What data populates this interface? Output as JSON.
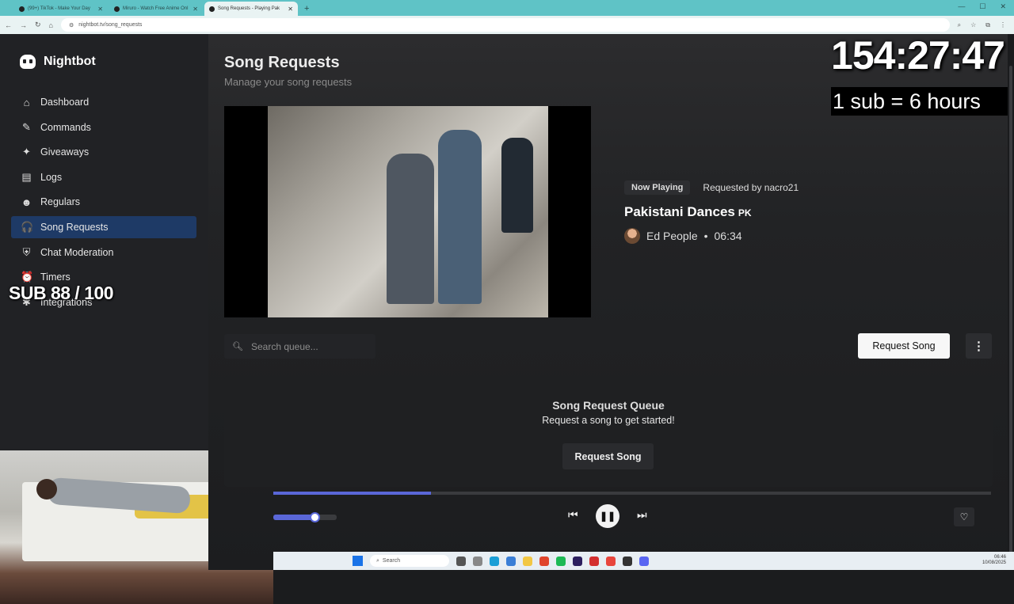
{
  "browser": {
    "tabs": [
      {
        "label": "(99+) TikTok - Make Your Day"
      },
      {
        "label": "Miruro - Watch Free Anime Onl"
      },
      {
        "label": "Song Requests - Playing Pak"
      }
    ],
    "new_tab": "+",
    "url": "nightbot.tv/song_requests"
  },
  "sidebar": {
    "brand": "Nightbot",
    "items": [
      {
        "label": "Dashboard",
        "icon": "⌂",
        "icon_name": "home-icon"
      },
      {
        "label": "Commands",
        "icon": "✎",
        "icon_name": "wand-icon"
      },
      {
        "label": "Giveaways",
        "icon": "✦",
        "icon_name": "giveaway-icon"
      },
      {
        "label": "Logs",
        "icon": "▤",
        "icon_name": "logs-icon"
      },
      {
        "label": "Regulars",
        "icon": "☻",
        "icon_name": "users-icon"
      },
      {
        "label": "Song Requests",
        "icon": "🎧",
        "icon_name": "headphones-icon",
        "active": true
      },
      {
        "label": "Chat Moderation",
        "icon": "⛨",
        "icon_name": "shield-icon"
      },
      {
        "label": "Timers",
        "icon": "⏰",
        "icon_name": "clock-icon"
      },
      {
        "label": "Integrations",
        "icon": "✱",
        "icon_name": "puzzle-icon"
      }
    ]
  },
  "overlay": {
    "sub_goal": "SUB 88 / 100",
    "timer": "154:27:47",
    "sub_rate": "1 sub = 6 hours"
  },
  "page": {
    "title": "Song Requests",
    "subtitle": "Manage your song requests"
  },
  "now_playing": {
    "badge": "Now Playing",
    "requested_by": "Requested by nacro21",
    "title": "Pakistani Dances",
    "country": "PK",
    "artist": "Ed People",
    "separator": "•",
    "duration": "06:34"
  },
  "search": {
    "placeholder": "Search queue..."
  },
  "toolbar": {
    "request_label": "Request Song"
  },
  "queue": {
    "title": "Song Request Queue",
    "subtitle": "Request a song to get started!",
    "button_label": "Request Song"
  },
  "player": {
    "progress": 0.22,
    "volume": 0.65
  },
  "taskbar": {
    "search_label": "Search",
    "time": "06:46",
    "date": "10/08/2025"
  },
  "colors": {
    "accent": "#5a67d8",
    "active_nav": "#1e3a66",
    "tabbar": "#5fc3c6"
  }
}
